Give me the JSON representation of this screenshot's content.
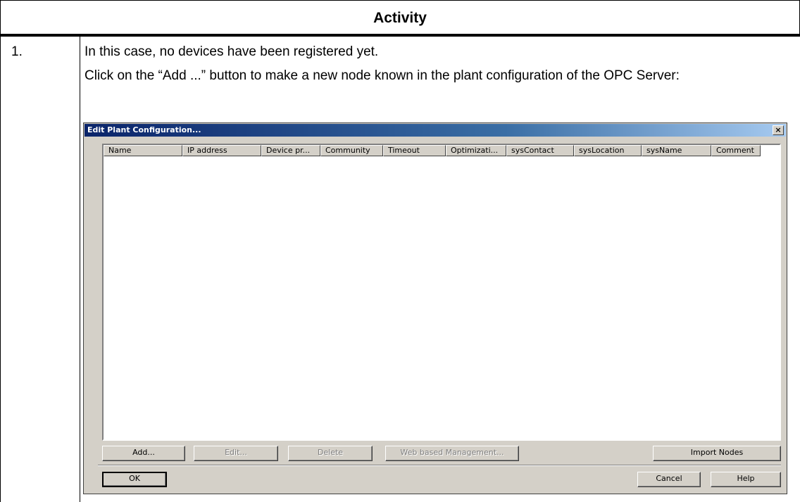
{
  "doc": {
    "header": "Activity",
    "row_number": "1.",
    "para1": "In this case, no devices have been registered yet.",
    "para2": "Click on the “Add ...” button to make a new node known in the plant configuration of the OPC Server:"
  },
  "dialog": {
    "title": "Edit Plant Configuration...",
    "close_glyph": "×",
    "columns": [
      "Name",
      "IP address",
      "Device pr...",
      "Community",
      "Timeout",
      "Optimizati...",
      "sysContact",
      "sysLocation",
      "sysName",
      "Comment"
    ],
    "buttons": {
      "add": "Add...",
      "edit": "Edit...",
      "delete": "Delete",
      "web": "Web based Management...",
      "import": "Import Nodes",
      "ok": "OK",
      "cancel": "Cancel",
      "help": "Help"
    }
  }
}
